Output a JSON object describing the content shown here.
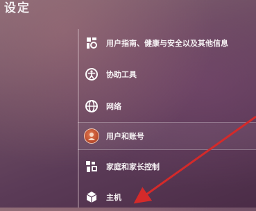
{
  "page": {
    "title": "设定"
  },
  "settings": {
    "items": [
      {
        "icon": "accessibility-guide-icon",
        "label": "用户指南、健康与安全以及其他信息"
      },
      {
        "icon": "accessibility-icon",
        "label": "协助工具"
      },
      {
        "icon": "globe-icon",
        "label": "网络"
      },
      {
        "icon": "user-avatar-icon",
        "label": "用户和账号"
      },
      {
        "icon": "family-icon",
        "label": "家庭和家长控制"
      },
      {
        "icon": "console-icon",
        "label": "主机"
      }
    ],
    "selected_index": 3
  },
  "annotation": {
    "color": "#d42a2a",
    "target": "主机"
  }
}
